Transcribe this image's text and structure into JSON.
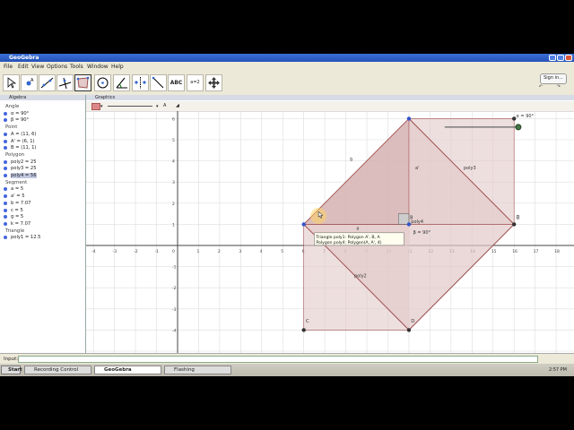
{
  "window": {
    "title": "GeoGebra"
  },
  "menu": [
    "File",
    "Edit",
    "View",
    "Options",
    "Tools",
    "Window",
    "Help"
  ],
  "toolbar": {
    "tools": [
      "move-tool",
      "point-tool",
      "line-tool",
      "perpendicular-tool",
      "polygon-tool",
      "circle-tool",
      "angle-tool",
      "reflect-tool",
      "slider-text-tool",
      "slider-tool",
      "move-view-tool"
    ],
    "tool_labels": {
      "text_tool": "ABC",
      "slider_tool": "a=2"
    },
    "signin": "Sign in...",
    "undo": "↶",
    "redo": "↷"
  },
  "algebra": {
    "title": "Algebra",
    "categories": [
      {
        "name": "Angle",
        "items": [
          "α = 90°",
          "β = 90°"
        ]
      },
      {
        "name": "Point",
        "items": [
          "A = (11, 6)",
          "A' = (6, 1)",
          "B = (11, 1)"
        ]
      },
      {
        "name": "Polygon",
        "items": [
          "poly2 = 25",
          "poly3 = 25",
          "poly4 = 56"
        ]
      },
      {
        "name": "Segment",
        "items": [
          "a = 5",
          "a' = 5",
          "b = 7.07",
          "c = 5",
          "g = 5",
          "k = 7.07"
        ]
      },
      {
        "name": "Triangle",
        "items": [
          "poly1 = 12.5"
        ]
      }
    ],
    "highlighted": "poly4 = 56"
  },
  "graphics": {
    "title": "Graphics",
    "x_ticks": [
      "-4",
      "-3",
      "-2",
      "-1",
      "0",
      "1",
      "2",
      "3",
      "4",
      "5",
      "6",
      "7",
      "8",
      "9",
      "10",
      "11",
      "12",
      "13",
      "14",
      "15",
      "16",
      "17",
      "18"
    ],
    "y_ticks": [
      "6",
      "5",
      "4",
      "3",
      "2",
      "1",
      "0",
      "-1",
      "-2",
      "-3",
      "-4"
    ],
    "labels": {
      "b": "b",
      "a_prime": "a'",
      "poly3": "poly3",
      "poly2": "poly2",
      "a": "a",
      "poly4": "poly4",
      "beta": "β = 90°",
      "alpha": "α = 90°",
      "B": "B",
      "C": "C",
      "D": "D",
      "B_small": "B"
    },
    "tooltip": {
      "line1": "Triangle poly1: Polygon A', B, A",
      "line2": "Polygon poly4: Polygon(A, A', 4)"
    }
  },
  "input": {
    "label": "Input:"
  },
  "taskbar": {
    "start": "Start",
    "tasks": [
      "Recording Control",
      "GeoGebra",
      "Flashing"
    ],
    "clock": "2:57 PM"
  },
  "colors": {
    "polygon_fill": "#e3c9c9",
    "polygon_stroke": "#a05050",
    "point": "#333333",
    "point_blue": "#3355cc",
    "axis": "#444444",
    "grid": "#dddddd"
  }
}
